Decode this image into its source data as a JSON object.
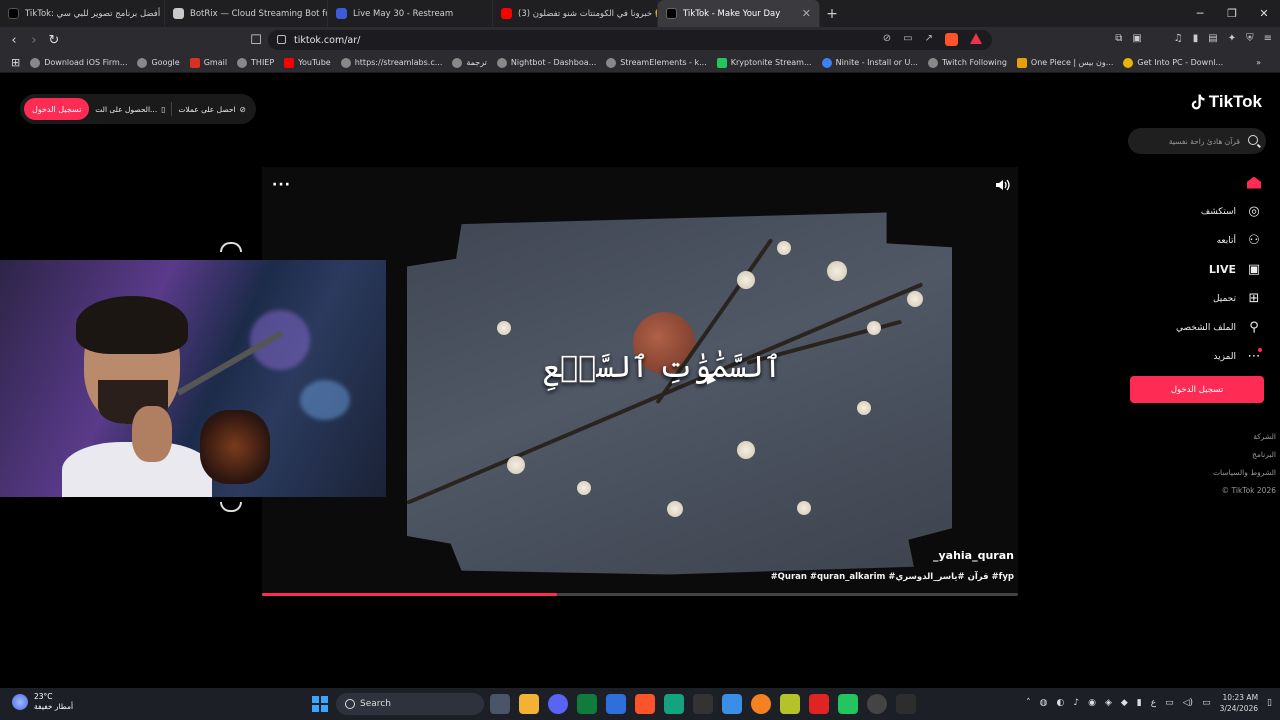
{
  "browser": {
    "tabs": [
      {
        "title": "TikTok: أفضل برنامج تصوير للبي سي",
        "color": "#000000",
        "active": false
      },
      {
        "title": "BotRix — Cloud Streaming Bot for Tw",
        "color": "#c9c9c9",
        "active": false
      },
      {
        "title": "Live May 30 - Restream",
        "color": "#3b5bdb",
        "active": false
      },
      {
        "title": "(3) خبرونا في الكومنتات شنو تفضلون 🍔",
        "color": "#ff0000",
        "active": false
      },
      {
        "title": "TikTok - Make Your Day",
        "color": "#000000",
        "active": true
      }
    ],
    "url": "tiktok.com/ar/",
    "bookmarks": [
      {
        "label": "Download iOS Firm...",
        "color": "#888888"
      },
      {
        "label": "Google",
        "color": "#888888"
      },
      {
        "label": "Gmail",
        "color": "#d93025"
      },
      {
        "label": "THIEP",
        "color": "#888888"
      },
      {
        "label": "YouTube",
        "color": "#ff0000"
      },
      {
        "label": "https://streamlabs.c...",
        "color": "#888888"
      },
      {
        "label": "ترجمة",
        "color": "#888888"
      },
      {
        "label": "Nightbot - Dashboa...",
        "color": "#888888"
      },
      {
        "label": "StreamElements - k...",
        "color": "#888888"
      },
      {
        "label": "Kryptonite Stream...",
        "color": "#22c55e"
      },
      {
        "label": "Ninite - Install or U...",
        "color": "#3b82f6"
      },
      {
        "label": "Twitch Following",
        "color": "#888888"
      },
      {
        "label": "One Piece | ون بيس...",
        "color": "#e5a00d"
      },
      {
        "label": "Get Into PC - Downl...",
        "color": "#eab308"
      }
    ]
  },
  "tiktok": {
    "logo": "TikTok",
    "search_placeholder": "قرآن هادئ راحة نفسية",
    "top_login": "تسجيل الدخول",
    "top_link_1": "الحصول على الت...",
    "top_link_2": "احصل على عملات",
    "nav": [
      {
        "label": "",
        "icon": "home-icon",
        "active": true
      },
      {
        "label": "استكشف",
        "icon": "compass-icon"
      },
      {
        "label": "أتابعه",
        "icon": "following-icon"
      },
      {
        "label": "LIVE",
        "icon": "live-icon"
      },
      {
        "label": "تحميل",
        "icon": "upload-icon"
      },
      {
        "label": "الملف الشخصي",
        "icon": "profile-icon"
      },
      {
        "label": "المزيد",
        "icon": "more-icon"
      }
    ],
    "side_login": "تسجيل الدخول",
    "footer": [
      "الشركة",
      "البرنامج",
      "الشروط والسياسات",
      "© TikTok 2026"
    ],
    "video": {
      "overlay_text": "ٱلسَّمَٰوَٰتِ ٱلسَّبۡعِ",
      "author": "_yahia_quran",
      "caption": "#Quran #quran_alkarim #قرآن #ياسر_الدوسري #fyp",
      "progress": 0.39
    }
  },
  "taskbar": {
    "temperature": "23°C",
    "weather": "أمطار خفيفة",
    "search": "Search",
    "time": "10:23 AM",
    "date": "3/24/2026",
    "lang": "ع"
  }
}
